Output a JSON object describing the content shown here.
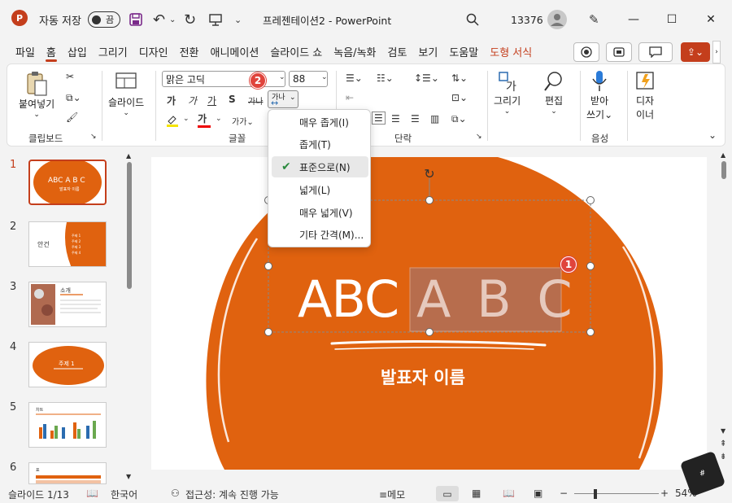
{
  "titlebar": {
    "logo": "P",
    "autosave_label": "자동 저장",
    "autosave_state": "끔",
    "doc_title": "프레젠테이션2 - PowerPoint",
    "account_number": "13376"
  },
  "tabs": [
    "파일",
    "홈",
    "삽입",
    "그리기",
    "디자인",
    "전환",
    "애니메이션",
    "슬라이드 쇼",
    "녹음/녹화",
    "검토",
    "보기",
    "도움말",
    "도형 서식"
  ],
  "ribbon": {
    "clipboard": {
      "paste": "붙여넣기",
      "label": "클립보드"
    },
    "slides": {
      "slide": "슬라이드"
    },
    "font": {
      "name": "맑은 고딕",
      "size": "88",
      "label": "글꼴",
      "spacing_btn": "가나"
    },
    "paragraph": {
      "label": "단락"
    },
    "drawing": {
      "draw": "그리기",
      "edit": "편집"
    },
    "voice": {
      "dictate_l1": "받아",
      "dictate_l2": "쓰기",
      "label": "음성"
    },
    "designer": {
      "l1": "디자",
      "l2": "이너"
    }
  },
  "spacing_menu": [
    {
      "label": "매우 좁게(I)",
      "checked": false
    },
    {
      "label": "좁게(T)",
      "checked": false
    },
    {
      "label": "표준으로(N)",
      "checked": true
    },
    {
      "label": "넓게(L)",
      "checked": false
    },
    {
      "label": "매우 넓게(V)",
      "checked": false
    },
    {
      "label": "기타 간격(M)...",
      "checked": false
    }
  ],
  "badges": {
    "one": "1",
    "two": "2"
  },
  "thumbnails": [
    {
      "num": "1",
      "text": "ABC A B C",
      "sub": "발표자 이름"
    },
    {
      "num": "2",
      "text": "안건",
      "items": [
        "주제 1",
        "주제 2",
        "주제 3",
        "주제 4"
      ]
    },
    {
      "num": "3",
      "text": "소개"
    },
    {
      "num": "4",
      "text": "주제 1"
    },
    {
      "num": "5",
      "text": "차트"
    },
    {
      "num": "6",
      "text": "표"
    }
  ],
  "slide": {
    "title_normal": "ABC",
    "title_spaced": "A B C",
    "presenter": "발표자 이름"
  },
  "status": {
    "slide_info": "슬라이드 1/13",
    "language": "한국어",
    "accessibility": "접근성: 계속 진행 가능",
    "notes": "메모",
    "zoom": "54%"
  },
  "colors": {
    "accent": "#c43e1c",
    "slide_orange": "#e0620f"
  }
}
